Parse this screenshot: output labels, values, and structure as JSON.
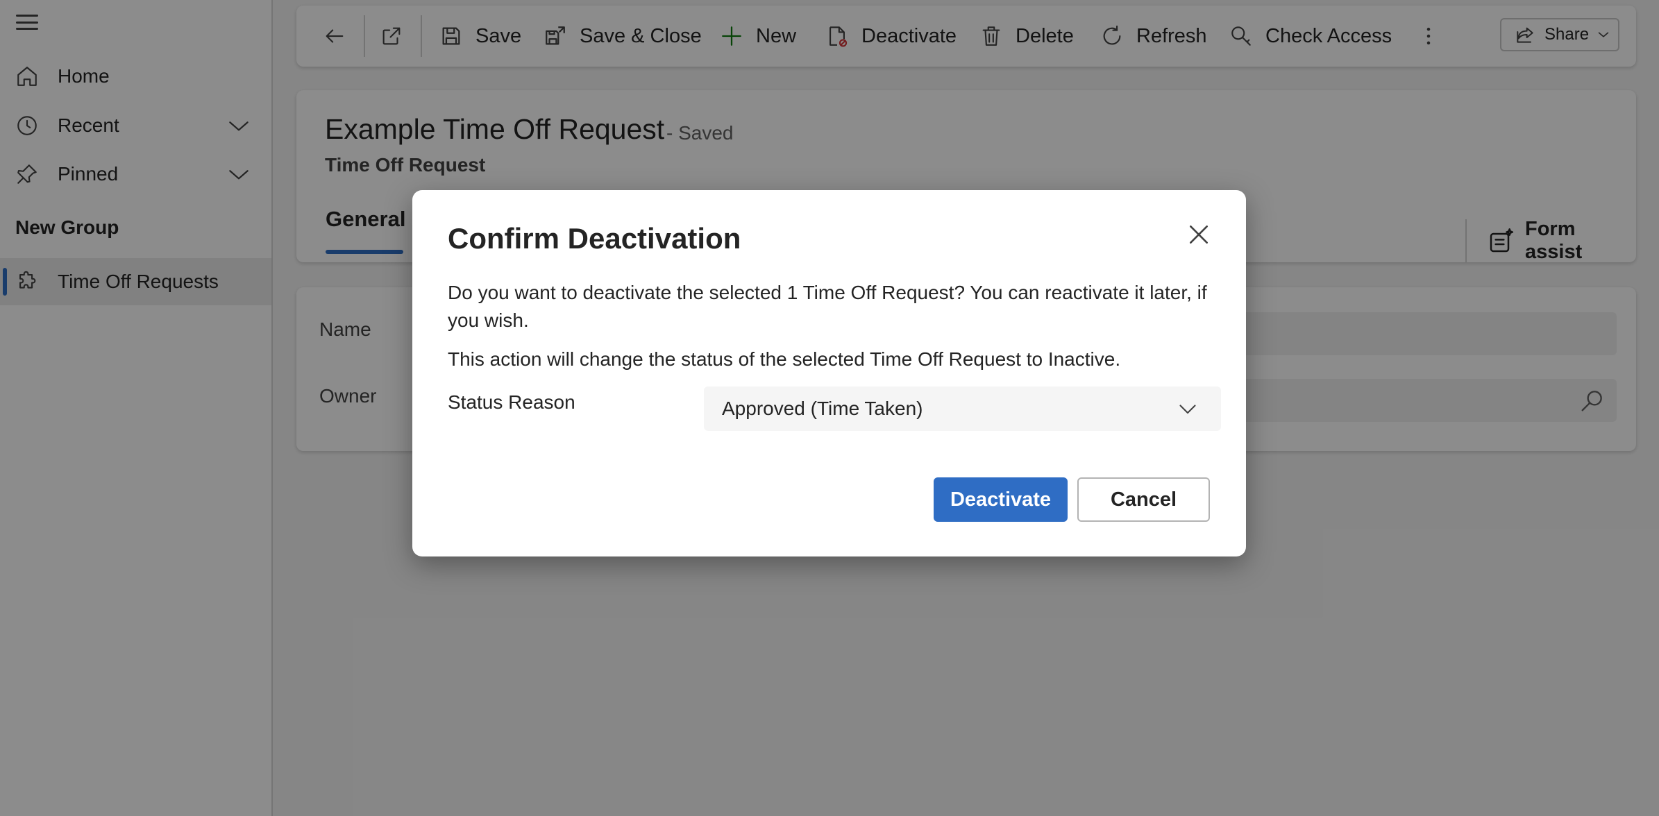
{
  "sidebar": {
    "items": [
      {
        "label": "Home",
        "icon": "home-icon"
      },
      {
        "label": "Recent",
        "icon": "clock-icon"
      },
      {
        "label": "Pinned",
        "icon": "pin-icon"
      }
    ],
    "group_title": "New Group",
    "group_items": [
      {
        "label": "Time Off Requests",
        "icon": "puzzle-icon",
        "selected": true
      }
    ]
  },
  "toolbar": {
    "save": "Save",
    "save_close": "Save & Close",
    "new": "New",
    "deactivate": "Deactivate",
    "delete": "Delete",
    "refresh": "Refresh",
    "check_access": "Check Access",
    "share": "Share"
  },
  "record": {
    "title": "Example Time Off Request",
    "saved_status": "- Saved",
    "entity": "Time Off Request",
    "tab": "General",
    "form_assist": "Form assist"
  },
  "form": {
    "name_label": "Name",
    "owner_label": "Owner"
  },
  "dialog": {
    "title": "Confirm Deactivation",
    "message": "Do you want to deactivate the selected 1 Time Off Request? You can reactivate it later, if you wish.",
    "status_message": "This action will change the status of the selected Time Off Request to Inactive.",
    "status_reason_label": "Status Reason",
    "status_reason_value": "Approved (Time Taken)",
    "confirm_label": "Deactivate",
    "cancel_label": "Cancel"
  },
  "colors": {
    "accent": "#2f6dc4",
    "overlay": "#000000",
    "new_icon": "#107c10",
    "deactivate_icon_badge": "#d13438"
  }
}
